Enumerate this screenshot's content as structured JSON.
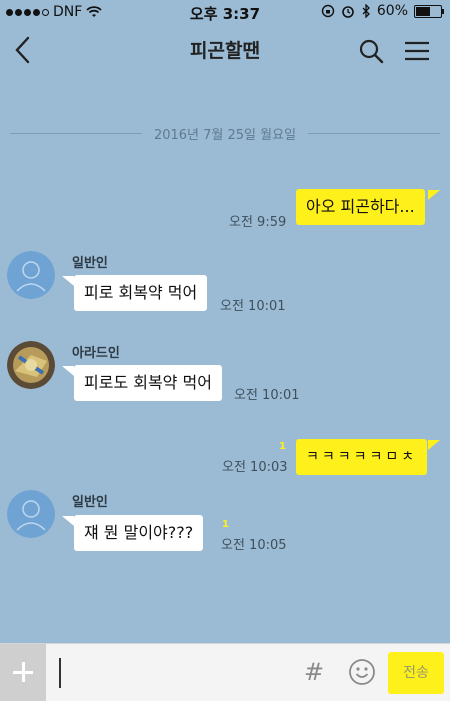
{
  "status_bar": {
    "carrier": "DNF",
    "time": "오후 3:37",
    "battery_text": "60%",
    "battery_level": 0.6
  },
  "nav": {
    "title": "피곤할땐",
    "back_icon": "back-chevron-icon",
    "search_icon": "search-icon",
    "menu_icon": "hamburger-menu-icon"
  },
  "date_divider": "2016년 7월 25일 월요일",
  "messages": [
    {
      "direction": "out",
      "text": "아오 피곤하다...",
      "time": "오전 9:59"
    },
    {
      "direction": "in",
      "sender": "일반인",
      "text": "피로 회복약 먹어",
      "time": "오전 10:01"
    },
    {
      "direction": "in",
      "sender": "아라드인",
      "text": "피로도 회복약 먹어",
      "time": "오전 10:01"
    },
    {
      "direction": "out",
      "text": "ㅋㅋㅋㅋㅋㅁㅊ",
      "time": "오전 10:03",
      "unread": "1"
    },
    {
      "direction": "in",
      "sender": "일반인",
      "text": "쟤 뭔 말이야???",
      "time": "오전 10:05",
      "unread": "1"
    }
  ],
  "input_bar": {
    "hash_label": "#",
    "send_label": "전송"
  },
  "colors": {
    "background": "#9bbbd4",
    "my_bubble": "#fef01b",
    "their_bubble": "#ffffff"
  }
}
